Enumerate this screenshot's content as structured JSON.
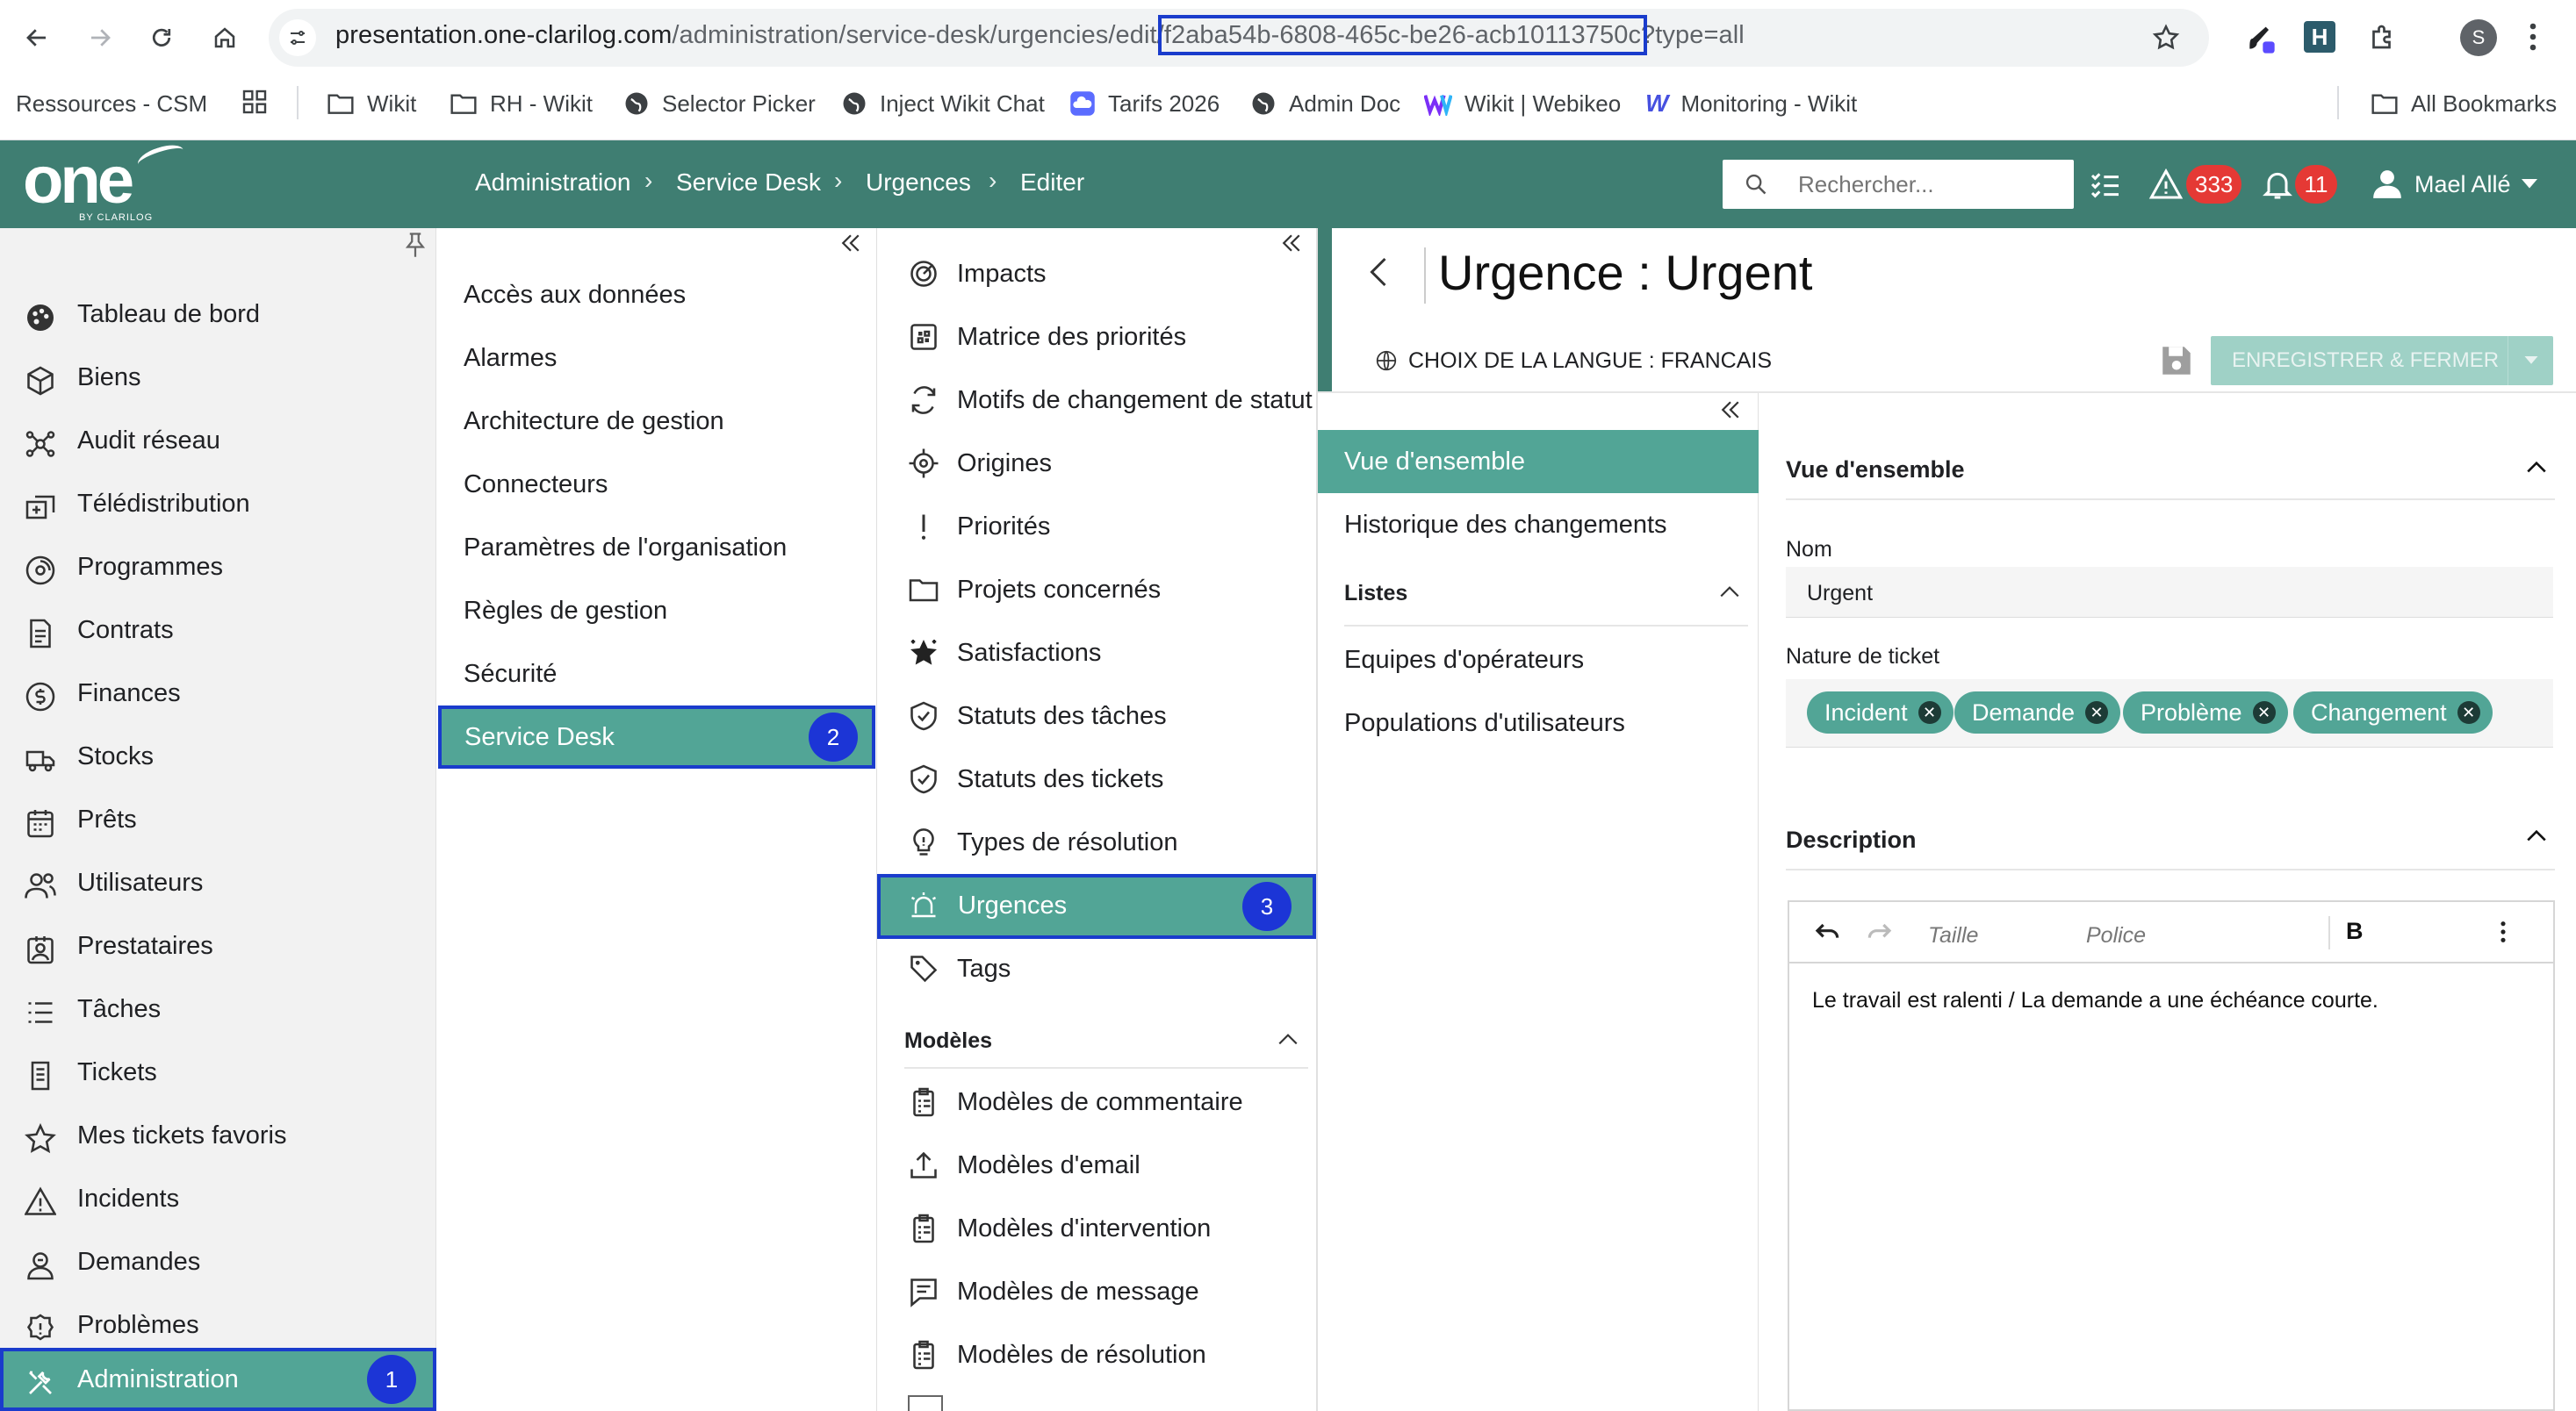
{
  "browser": {
    "url_host": "presentation.one-clarilog.com",
    "url_path": "/administration/service-desk/urgencies/edit/",
    "url_id": "f2aba54b-6808-465c-be26-acb10113750c",
    "url_query": "?type=all",
    "profile_initial": "S",
    "bookmarks": [
      "Ressources - CSM",
      "Wikit",
      "RH - Wikit",
      "Selector Picker",
      "Inject Wikit Chat",
      "Tarifs 2026",
      "Admin Doc",
      "Wikit | Webikeo",
      "Monitoring - Wikit"
    ],
    "all_bookmarks": "All Bookmarks"
  },
  "header": {
    "logo": "one",
    "logo_sub": "BY CLARILOG",
    "breadcrumb": [
      "Administration",
      "Service Desk",
      "Urgences",
      "Editer"
    ],
    "search_placeholder": "Rechercher...",
    "alert_count": "333",
    "notification_count": "11",
    "user_name": "Mael Allé"
  },
  "sidebar": {
    "items": [
      {
        "label": "Tableau de bord",
        "icon": "palette-icon"
      },
      {
        "label": "Biens",
        "icon": "cube-icon"
      },
      {
        "label": "Audit réseau",
        "icon": "network-icon"
      },
      {
        "label": "Télédistribution",
        "icon": "deploy-icon"
      },
      {
        "label": "Programmes",
        "icon": "disc-icon"
      },
      {
        "label": "Contrats",
        "icon": "contract-icon"
      },
      {
        "label": "Finances",
        "icon": "money-icon"
      },
      {
        "label": "Stocks",
        "icon": "truck-icon"
      },
      {
        "label": "Prêts",
        "icon": "calendar-icon"
      },
      {
        "label": "Utilisateurs",
        "icon": "users-icon"
      },
      {
        "label": "Prestataires",
        "icon": "provider-icon"
      },
      {
        "label": "Tâches",
        "icon": "tasks-icon"
      },
      {
        "label": "Tickets",
        "icon": "ticket-icon"
      },
      {
        "label": "Mes tickets favoris",
        "icon": "star-icon"
      },
      {
        "label": "Incidents",
        "icon": "warning-icon"
      },
      {
        "label": "Demandes",
        "icon": "request-icon"
      },
      {
        "label": "Problèmes",
        "icon": "problem-icon"
      }
    ],
    "active_label": "Administration",
    "active_badge": "1"
  },
  "admin_menu": {
    "items": [
      "Accès aux données",
      "Alarmes",
      "Architecture de gestion",
      "Connecteurs",
      "Paramètres de l'organisation",
      "Règles de gestion",
      "Sécurité"
    ],
    "active_label": "Service Desk",
    "active_badge": "2"
  },
  "service_desk_menu": {
    "items": [
      {
        "label": "Impacts",
        "icon": "impact-icon"
      },
      {
        "label": "Matrice des priorités",
        "icon": "matrix-icon"
      },
      {
        "label": "Motifs de changement de statut",
        "icon": "refresh-icon"
      },
      {
        "label": "Origines",
        "icon": "target-icon"
      },
      {
        "label": "Priorités",
        "icon": "exclamation-icon"
      },
      {
        "label": "Projets concernés",
        "icon": "folder-icon"
      },
      {
        "label": "Satisfactions",
        "icon": "sparkle-star-icon"
      },
      {
        "label": "Statuts des tâches",
        "icon": "shield-icon"
      },
      {
        "label": "Statuts des tickets",
        "icon": "shield-icon"
      },
      {
        "label": "Types de résolution",
        "icon": "bulb-icon"
      }
    ],
    "active_label": "Urgences",
    "active_badge": "3",
    "after_items": [
      {
        "label": "Tags",
        "icon": "tag-icon"
      }
    ],
    "models_title": "Modèles",
    "models": [
      {
        "label": "Modèles de commentaire",
        "icon": "clipboard-icon"
      },
      {
        "label": "Modèles d'email",
        "icon": "upload-icon"
      },
      {
        "label": "Modèles d'intervention",
        "icon": "clipboard-icon"
      },
      {
        "label": "Modèles de message",
        "icon": "message-icon"
      },
      {
        "label": "Modèles de résolution",
        "icon": "clipboard-icon"
      }
    ]
  },
  "detail": {
    "title": "Urgence : Urgent",
    "language_label": "CHOIX DE LA LANGUE : FRANCAIS",
    "save_close_label": "ENREGISTRER & FERMER",
    "subnav": {
      "active": "Vue d'ensemble",
      "items": [
        "Historique des changements"
      ],
      "lists_title": "Listes",
      "lists": [
        "Equipes d'opérateurs",
        "Populations d'utilisateurs"
      ]
    },
    "overview_title": "Vue d'ensemble",
    "name_label": "Nom",
    "name_value": "Urgent",
    "nature_label": "Nature de ticket",
    "nature_tags": [
      "Incident",
      "Demande",
      "Problème",
      "Changement"
    ],
    "description_title": "Description",
    "editor_size_placeholder": "Taille",
    "editor_font_placeholder": "Police",
    "editor_bold": "B",
    "description_text": "Le travail est ralenti / La demande a une échéance courte."
  },
  "colors": {
    "brand": "#3f7e72",
    "active": "#52a596",
    "highlight": "#1a3ccc",
    "badge": "#e53935"
  }
}
